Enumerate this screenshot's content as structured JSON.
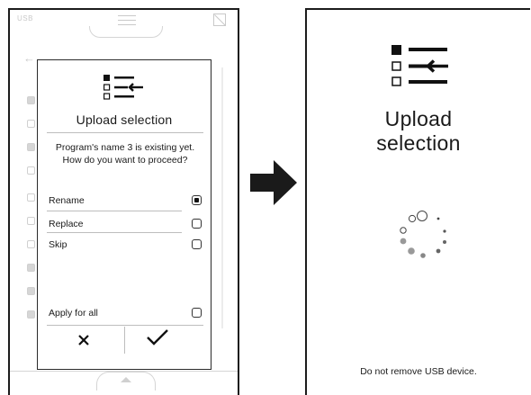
{
  "left_screen": {
    "top_label": "USB"
  },
  "dialog": {
    "icon": "upload-list-icon",
    "title": "Upload selection",
    "message_line1": "Program's name 3 is existing yet.",
    "message_line2": "How do you want to proceed?",
    "options": [
      {
        "label": "Rename",
        "checked": true
      },
      {
        "label": "Replace",
        "checked": false
      },
      {
        "label": "Skip",
        "checked": false
      }
    ],
    "apply_all": {
      "label": "Apply for all",
      "checked": false
    },
    "cancel_icon": "close-icon",
    "confirm_icon": "check-icon"
  },
  "transition_icon": "arrow-right-icon",
  "right_screen": {
    "icon": "upload-list-icon",
    "title_line1": "Upload",
    "title_line2": "selection",
    "spinner_icon": "loading-spinner-icon",
    "footer": "Do not remove USB device."
  },
  "colors": {
    "frame": "#1c1c1c",
    "background": "#ffffff",
    "faded_background": "#c9c9c9",
    "separator": "#bdbdbd"
  }
}
